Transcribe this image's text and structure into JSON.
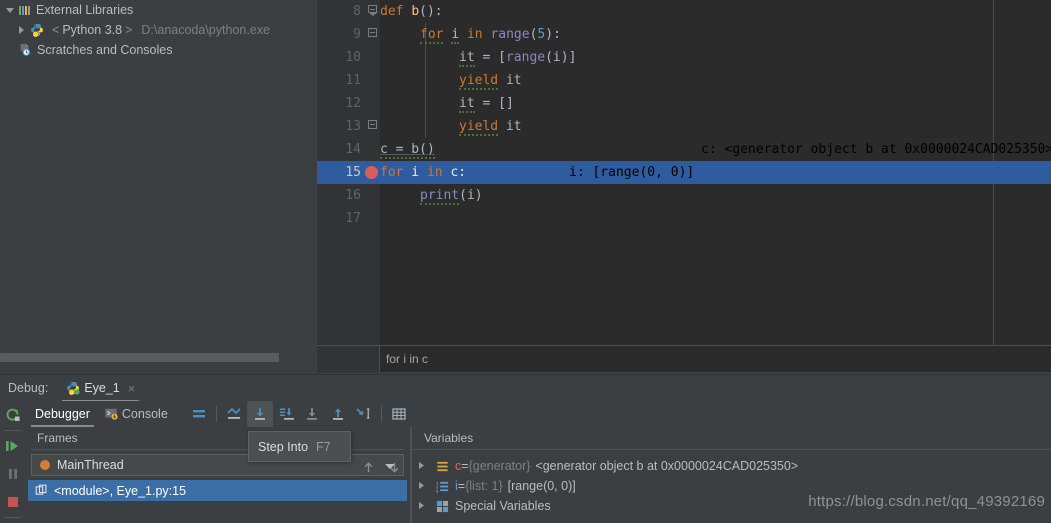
{
  "project_tree": {
    "items": [
      {
        "label": "External Libraries",
        "icon": "library-icon",
        "arrow": "down",
        "indent": 0
      },
      {
        "label": "< Python 3.8 >",
        "prefix": "<",
        "name": "Python 3.8",
        "suffix": ">",
        "path": "D:\\anacoda\\python.exe",
        "icon": "python-icon",
        "arrow": "right",
        "indent": 1
      },
      {
        "label": "Scratches and Consoles",
        "icon": "scratches-icon",
        "arrow": "blank",
        "indent": 0
      }
    ]
  },
  "editor": {
    "lines": [
      {
        "num": "8",
        "text": "def b():"
      },
      {
        "num": "9",
        "text": "    for i in range(5):"
      },
      {
        "num": "10",
        "text": "        it = [range(i)]"
      },
      {
        "num": "11",
        "text": "        yield it"
      },
      {
        "num": "12",
        "text": "        it = []"
      },
      {
        "num": "13",
        "text": "        yield it"
      },
      {
        "num": "14",
        "text": "c = b()",
        "inline_hint": "c: <generator object b at 0x0000024CAD025350>"
      },
      {
        "num": "15",
        "text": "for i in c:",
        "inline_hint": "i: [range(0, 0)]",
        "highlighted": true,
        "breakpoint": true
      },
      {
        "num": "16",
        "text": "    print(i)"
      },
      {
        "num": "17",
        "text": ""
      }
    ],
    "breadcrumb": "for i in c"
  },
  "debug": {
    "label": "Debug:",
    "tab_name": "Eye_1",
    "tab_close": "×",
    "tabs": [
      {
        "label": "Debugger",
        "active": true
      },
      {
        "label": "Console",
        "active": false
      }
    ],
    "toolbar_icons": [
      "mute-breakpoints-icon",
      "show-execution-point-icon",
      "step-over-icon",
      "step-into-icon",
      "step-into-my-code-icon",
      "force-step-into-icon",
      "step-out-icon",
      "run-to-cursor-icon",
      "evaluate-expression-icon"
    ],
    "left_toolbar_icons": [
      "rerun-icon",
      "resume-program-icon",
      "pause-program-icon",
      "stop-icon"
    ],
    "tooltip": {
      "label": "Step Into",
      "shortcut": "F7"
    }
  },
  "frames": {
    "title": "Frames",
    "thread": "MainThread",
    "frame": "<module>, Eye_1.py:15",
    "nav_up": "up-arrow-icon",
    "nav_down": "down-arrow-icon"
  },
  "variables": {
    "title": "Variables",
    "rows": [
      {
        "icon": "generator-icon",
        "name": "c",
        "eq": " = ",
        "type": "{generator}",
        "value": "<generator object b at 0x0000024CAD025350>"
      },
      {
        "icon": "list-icon",
        "name": "i",
        "eq": " = ",
        "type": "{list: 1}",
        "value": "[range(0, 0)]"
      },
      {
        "icon": "special-variables-icon",
        "name": "Special Variables",
        "eq": "",
        "type": "",
        "value": ""
      }
    ]
  },
  "watermark": "https://blog.csdn.net/qq_49392169",
  "colors": {
    "panel_bg": "#3c3f41",
    "editor_bg": "#2b2b2b",
    "gutter_bg": "#313335",
    "highlight_blue": "#2f5c9e",
    "selection_blue": "#3a6ea5",
    "keyword_orange": "#cc7832",
    "function_yellow": "#ffc66d",
    "number_blue": "#6897bb",
    "text_gray": "#a9b7c6",
    "breakpoint_red": "#db5c5c"
  }
}
